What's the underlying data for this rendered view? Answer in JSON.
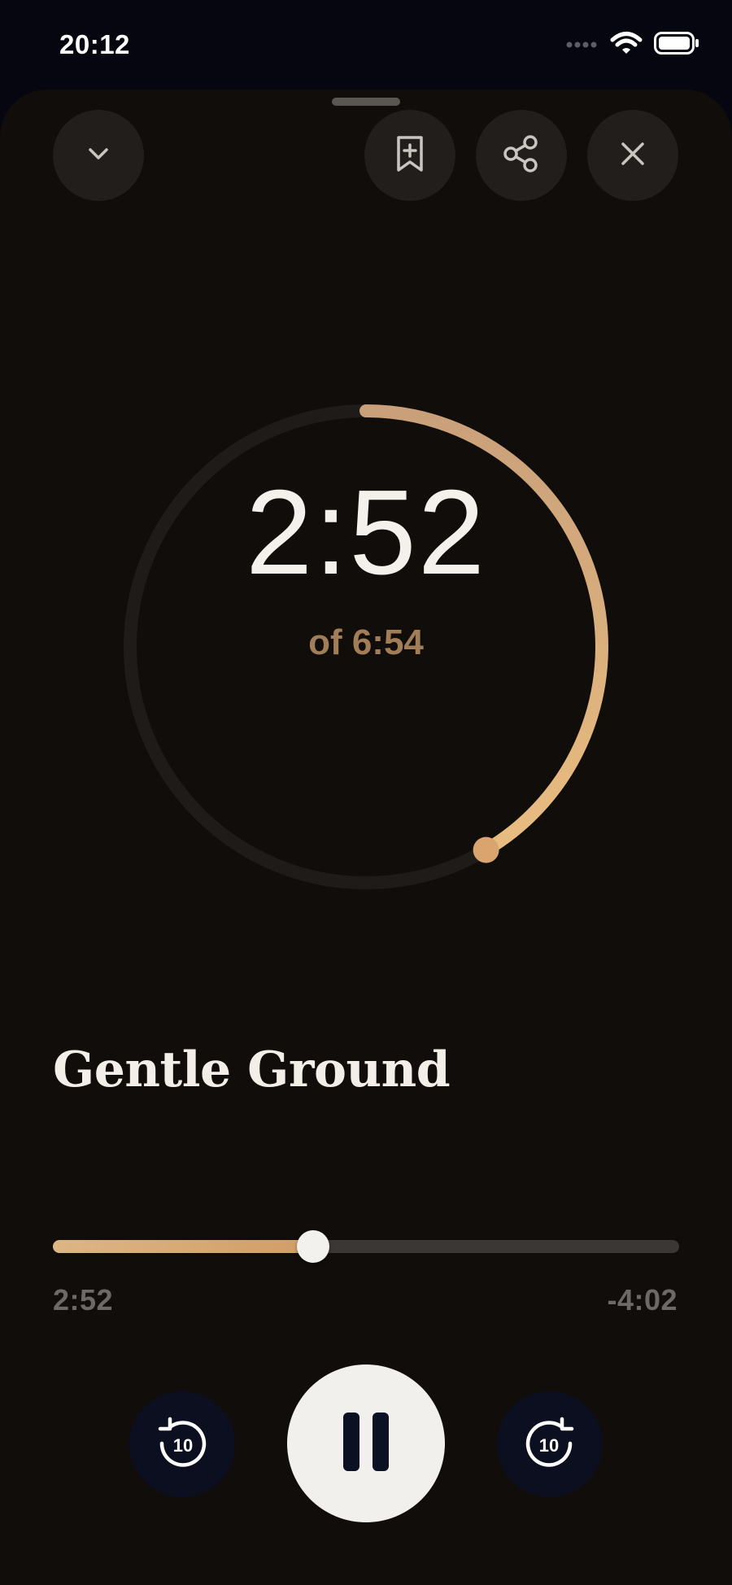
{
  "status_bar": {
    "time": "20:12",
    "icons": [
      "cellular-signal-icon",
      "wifi-icon",
      "battery-icon"
    ]
  },
  "header": {
    "buttons": [
      {
        "name": "collapse",
        "icon": "chevron-down-icon"
      },
      {
        "name": "bookmark",
        "icon": "bookmark-add-icon"
      },
      {
        "name": "share",
        "icon": "share-icon"
      },
      {
        "name": "close",
        "icon": "close-icon"
      }
    ]
  },
  "timer": {
    "elapsed": "2:52",
    "total_label": "of 6:54",
    "progress_fraction": 0.415
  },
  "track": {
    "title": "Gentle Ground",
    "elapsed": "2:52",
    "remaining": "-4:02",
    "progress_fraction": 0.415
  },
  "controls": {
    "rewind_seconds": "10",
    "forward_seconds": "10",
    "state": "playing"
  },
  "colors": {
    "accent": "#d5a06a",
    "background": "#110d0a",
    "ring_track": "#221e1b"
  }
}
